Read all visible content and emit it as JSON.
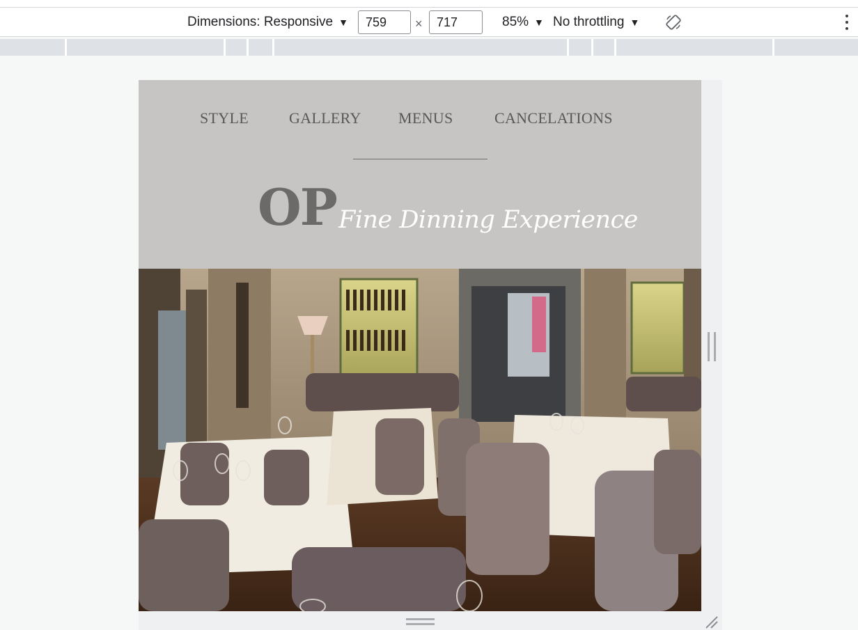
{
  "toolbar": {
    "dimensions_label": "Dimensions: Responsive",
    "width_value": "759",
    "height_value": "717",
    "times_symbol": "×",
    "zoom_label": "85%",
    "throttle_label": "No throttling",
    "rotate_icon": "rotate-icon",
    "more_icon": "more-vert-icon"
  },
  "site": {
    "nav": [
      "STYLE",
      "GALLERY",
      "MENUS",
      "CANCELATIONS"
    ],
    "logo_text": "OP",
    "tagline": "Fine Dinning Experience",
    "hero_alt": "Restaurant dining room with set tables, velvet chairs and a wine bar",
    "colors": {
      "header_bg": "#c7c5c3",
      "nav_text": "#5a5856",
      "logo": "#6b6a69",
      "tagline": "#ffffff"
    }
  }
}
